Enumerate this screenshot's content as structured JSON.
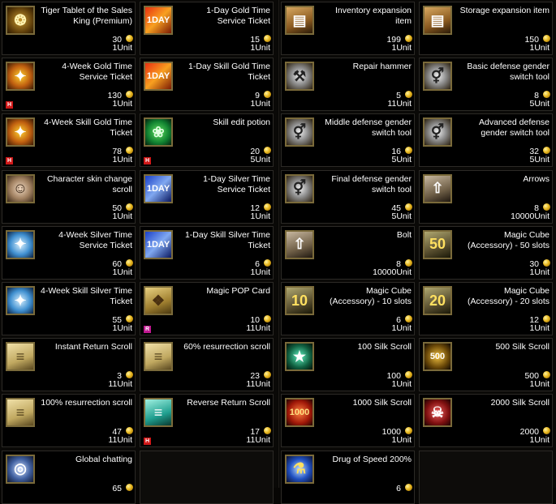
{
  "coin_color": "#e8b820",
  "left_items": [
    {
      "name": "Tiger Tablet of the Sales King (Premium)",
      "price": "30",
      "unit": "1Unit",
      "icon": "tablet-icon",
      "glyph": "❂",
      "theme": "i-tablet",
      "badge": ""
    },
    {
      "name": "1-Day Gold Time Service Ticket",
      "price": "15",
      "unit": "1Unit",
      "icon": "day-ticket-gold-icon",
      "glyph": "1DAY",
      "theme": "i-day-gold",
      "badge": ""
    },
    {
      "name": "4-Week Gold Time Service Ticket",
      "price": "130",
      "unit": "1Unit",
      "icon": "gold-ring-icon",
      "glyph": "✦",
      "theme": "i-gold-ring",
      "badge": "H"
    },
    {
      "name": "1-Day Skill Gold Time Ticket",
      "price": "9",
      "unit": "1Unit",
      "icon": "day-ticket-gold-icon",
      "glyph": "1DAY",
      "theme": "i-day-gold",
      "badge": ""
    },
    {
      "name": "4-Week Skill Gold Time Ticket",
      "price": "78",
      "unit": "1Unit",
      "icon": "gold-ring-icon",
      "glyph": "✦",
      "theme": "i-gold-ring",
      "badge": "H"
    },
    {
      "name": "Skill edit potion",
      "price": "20",
      "unit": "5Unit",
      "icon": "potion-icon",
      "glyph": "❀",
      "theme": "i-potion",
      "badge": "H"
    },
    {
      "name": "Character skin change scroll",
      "price": "50",
      "unit": "1Unit",
      "icon": "face-icon",
      "glyph": "☺",
      "theme": "i-face",
      "badge": ""
    },
    {
      "name": "1-Day Silver Time Service Ticket",
      "price": "12",
      "unit": "1Unit",
      "icon": "day-ticket-silver-icon",
      "glyph": "1DAY",
      "theme": "i-day-silver",
      "badge": ""
    },
    {
      "name": "4-Week Silver Time Service Ticket",
      "price": "60",
      "unit": "1Unit",
      "icon": "silver-ring-icon",
      "glyph": "✦",
      "theme": "i-silver-ring",
      "badge": ""
    },
    {
      "name": "1-Day Skill Silver Time Ticket",
      "price": "6",
      "unit": "1Unit",
      "icon": "day-ticket-silver-icon",
      "glyph": "1DAY",
      "theme": "i-day-silver",
      "badge": ""
    },
    {
      "name": "4-Week Skill Silver Time Ticket",
      "price": "55",
      "unit": "1Unit",
      "icon": "silver-ring-icon",
      "glyph": "✦",
      "theme": "i-silver-ring",
      "badge": ""
    },
    {
      "name": "Magic POP Card",
      "price": "10",
      "unit": "11Unit",
      "icon": "card-icon",
      "glyph": "❖",
      "theme": "i-card",
      "badge": "R"
    },
    {
      "name": "Instant Return Scroll",
      "price": "3",
      "unit": "11Unit",
      "icon": "scroll-icon",
      "glyph": "≡",
      "theme": "i-scroll",
      "badge": ""
    },
    {
      "name": "60% resurrection scroll",
      "price": "23",
      "unit": "11Unit",
      "icon": "scroll-icon",
      "glyph": "≡",
      "theme": "i-scroll",
      "badge": ""
    },
    {
      "name": "100% resurrection scroll",
      "price": "47",
      "unit": "11Unit",
      "icon": "scroll-icon",
      "glyph": "≡",
      "theme": "i-scroll",
      "badge": ""
    },
    {
      "name": "Reverse Return Scroll",
      "price": "17",
      "unit": "11Unit",
      "icon": "scroll-teal-icon",
      "glyph": "≡",
      "theme": "i-scroll-teal",
      "badge": "H"
    },
    {
      "name": "Global chatting",
      "price": "65",
      "unit": "",
      "icon": "globe-icon",
      "glyph": "◎",
      "theme": "i-globe",
      "badge": ""
    },
    null
  ],
  "right_items": [
    {
      "name": "Inventory expansion item",
      "price": "199",
      "unit": "1Unit",
      "icon": "chest-icon",
      "glyph": "▤",
      "theme": "i-chest",
      "badge": ""
    },
    {
      "name": "Storage expansion item",
      "price": "150",
      "unit": "1Unit",
      "icon": "chest-icon",
      "glyph": "▤",
      "theme": "i-chest",
      "badge": ""
    },
    {
      "name": "Repair hammer",
      "price": "5",
      "unit": "11Unit",
      "icon": "hammer-icon",
      "glyph": "⚒",
      "theme": "i-tool",
      "badge": ""
    },
    {
      "name": "Basic defense gender switch tool",
      "price": "8",
      "unit": "5Unit",
      "icon": "gender-tool-icon",
      "glyph": "⚥",
      "theme": "i-tool",
      "badge": ""
    },
    {
      "name": "Middle defense gender switch tool",
      "price": "16",
      "unit": "5Unit",
      "icon": "gender-tool-icon",
      "glyph": "⚥",
      "theme": "i-tool",
      "badge": ""
    },
    {
      "name": "Advanced defense gender switch tool",
      "price": "32",
      "unit": "5Unit",
      "icon": "gender-tool-icon",
      "glyph": "⚥",
      "theme": "i-tool",
      "badge": ""
    },
    {
      "name": "Final defense gender switch tool",
      "price": "45",
      "unit": "5Unit",
      "icon": "gender-tool-icon",
      "glyph": "⚥",
      "theme": "i-tool",
      "badge": ""
    },
    {
      "name": "Arrows",
      "price": "8",
      "unit": "10000Unit",
      "icon": "arrows-icon",
      "glyph": "⇧",
      "theme": "i-arrows",
      "badge": ""
    },
    {
      "name": "Bolt",
      "price": "8",
      "unit": "10000Unit",
      "icon": "bolt-icon",
      "glyph": "⇧",
      "theme": "i-arrows",
      "badge": ""
    },
    {
      "name": "Magic Cube (Accessory) - 50 slots",
      "price": "30",
      "unit": "1Unit",
      "icon": "magic-cube-icon",
      "glyph": "50",
      "theme": "i-cube",
      "badge": ""
    },
    {
      "name": "Magic Cube (Accessory) - 10 slots",
      "price": "6",
      "unit": "1Unit",
      "icon": "magic-cube-icon",
      "glyph": "10",
      "theme": "i-cube",
      "badge": ""
    },
    {
      "name": "Magic Cube (Accessory) - 20 slots",
      "price": "12",
      "unit": "1Unit",
      "icon": "magic-cube-icon",
      "glyph": "20",
      "theme": "i-cube",
      "badge": ""
    },
    {
      "name": "100 Silk Scroll",
      "price": "100",
      "unit": "1Unit",
      "icon": "silk-scroll-icon",
      "glyph": "★",
      "theme": "i-silk-green",
      "badge": ""
    },
    {
      "name": "500 Silk Scroll",
      "price": "500",
      "unit": "1Unit",
      "icon": "silk-scroll-icon",
      "glyph": "500",
      "theme": "i-silk-gold",
      "badge": ""
    },
    {
      "name": "1000 Silk Scroll",
      "price": "1000",
      "unit": "1Unit",
      "icon": "silk-scroll-icon",
      "glyph": "1000",
      "theme": "i-silk-red",
      "badge": ""
    },
    {
      "name": "2000 Silk Scroll",
      "price": "2000",
      "unit": "1Unit",
      "icon": "silk-scroll-icon",
      "glyph": "☠",
      "theme": "i-silk-crimson",
      "badge": ""
    },
    {
      "name": "Drug of Speed 200%",
      "price": "6",
      "unit": "",
      "icon": "speed-drug-icon",
      "glyph": "⚗",
      "theme": "i-drug",
      "badge": ""
    },
    null
  ]
}
